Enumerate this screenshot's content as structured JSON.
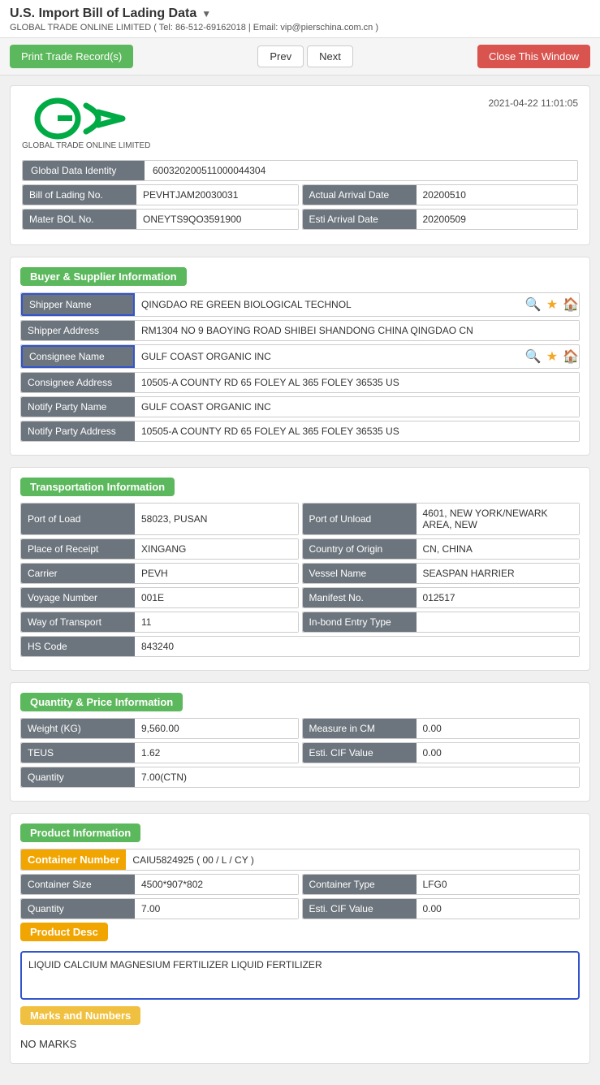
{
  "header": {
    "title": "U.S. Import Bill of Lading Data",
    "dropdown_arrow": "▼",
    "company_info": "GLOBAL TRADE ONLINE LIMITED ( Tel: 86-512-69162018 | Email: vip@pierschina.com.cn )"
  },
  "toolbar": {
    "print_btn": "Print Trade Record(s)",
    "prev_btn": "Prev",
    "next_btn": "Next",
    "close_btn": "Close This Window"
  },
  "record": {
    "timestamp": "2021-04-22 11:01:05",
    "logo_text": "GLOBAL TRADE ONLINE LIMITED",
    "global_data_identity": {
      "label": "Global Data Identity",
      "value": "600320200511000044304"
    },
    "bill_of_lading_no": {
      "label": "Bill of Lading No.",
      "value": "PEVHTJAM20030031"
    },
    "actual_arrival_date": {
      "label": "Actual Arrival Date",
      "value": "20200510"
    },
    "mater_bol_no": {
      "label": "Mater BOL No.",
      "value": "ONEYTS9QO3591900"
    },
    "esti_arrival_date": {
      "label": "Esti Arrival Date",
      "value": "20200509"
    }
  },
  "buyer_supplier": {
    "section_title": "Buyer & Supplier Information",
    "shipper_name": {
      "label": "Shipper Name",
      "value": "QINGDAO RE GREEN BIOLOGICAL TECHNOL"
    },
    "shipper_address": {
      "label": "Shipper Address",
      "value": "RM1304 NO 9 BAOYING ROAD SHIBEI SHANDONG CHINA QINGDAO CN"
    },
    "consignee_name": {
      "label": "Consignee Name",
      "value": "GULF COAST ORGANIC INC"
    },
    "consignee_address": {
      "label": "Consignee Address",
      "value": "10505-A COUNTY RD 65 FOLEY AL 365 FOLEY 36535 US"
    },
    "notify_party_name": {
      "label": "Notify Party Name",
      "value": "GULF COAST ORGANIC INC"
    },
    "notify_party_address": {
      "label": "Notify Party Address",
      "value": "10505-A COUNTY RD 65 FOLEY AL 365 FOLEY 36535 US"
    }
  },
  "transportation": {
    "section_title": "Transportation Information",
    "port_of_load": {
      "label": "Port of Load",
      "value": "58023, PUSAN"
    },
    "port_of_unload": {
      "label": "Port of Unload",
      "value": "4601, NEW YORK/NEWARK AREA, NEW"
    },
    "place_of_receipt": {
      "label": "Place of Receipt",
      "value": "XINGANG"
    },
    "country_of_origin": {
      "label": "Country of Origin",
      "value": "CN, CHINA"
    },
    "carrier": {
      "label": "Carrier",
      "value": "PEVH"
    },
    "vessel_name": {
      "label": "Vessel Name",
      "value": "SEASPAN HARRIER"
    },
    "voyage_number": {
      "label": "Voyage Number",
      "value": "001E"
    },
    "manifest_no": {
      "label": "Manifest No.",
      "value": "012517"
    },
    "way_of_transport": {
      "label": "Way of Transport",
      "value": "11"
    },
    "inbond_entry_type": {
      "label": "In-bond Entry Type",
      "value": ""
    },
    "hs_code": {
      "label": "HS Code",
      "value": "843240"
    }
  },
  "quantity_price": {
    "section_title": "Quantity & Price Information",
    "weight_kg": {
      "label": "Weight (KG)",
      "value": "9,560.00"
    },
    "measure_in_cm": {
      "label": "Measure in CM",
      "value": "0.00"
    },
    "teus": {
      "label": "TEUS",
      "value": "1.62"
    },
    "esti_cif_value": {
      "label": "Esti. CIF Value",
      "value": "0.00"
    },
    "quantity": {
      "label": "Quantity",
      "value": "7.00(CTN)"
    }
  },
  "product_info": {
    "section_title": "Product Information",
    "container_number": {
      "label": "Container Number",
      "value": "CAIU5824925 ( 00 / L / CY )"
    },
    "container_size": {
      "label": "Container Size",
      "value": "4500*907*802"
    },
    "container_type": {
      "label": "Container Type",
      "value": "LFG0"
    },
    "quantity": {
      "label": "Quantity",
      "value": "7.00"
    },
    "esti_cif_value": {
      "label": "Esti. CIF Value",
      "value": "0.00"
    },
    "product_desc": {
      "label": "Product Desc",
      "value": "LIQUID CALCIUM MAGNESIUM FERTILIZER LIQUID FERTILIZER"
    },
    "marks_and_numbers": {
      "label": "Marks and Numbers",
      "value": "NO MARKS"
    }
  }
}
